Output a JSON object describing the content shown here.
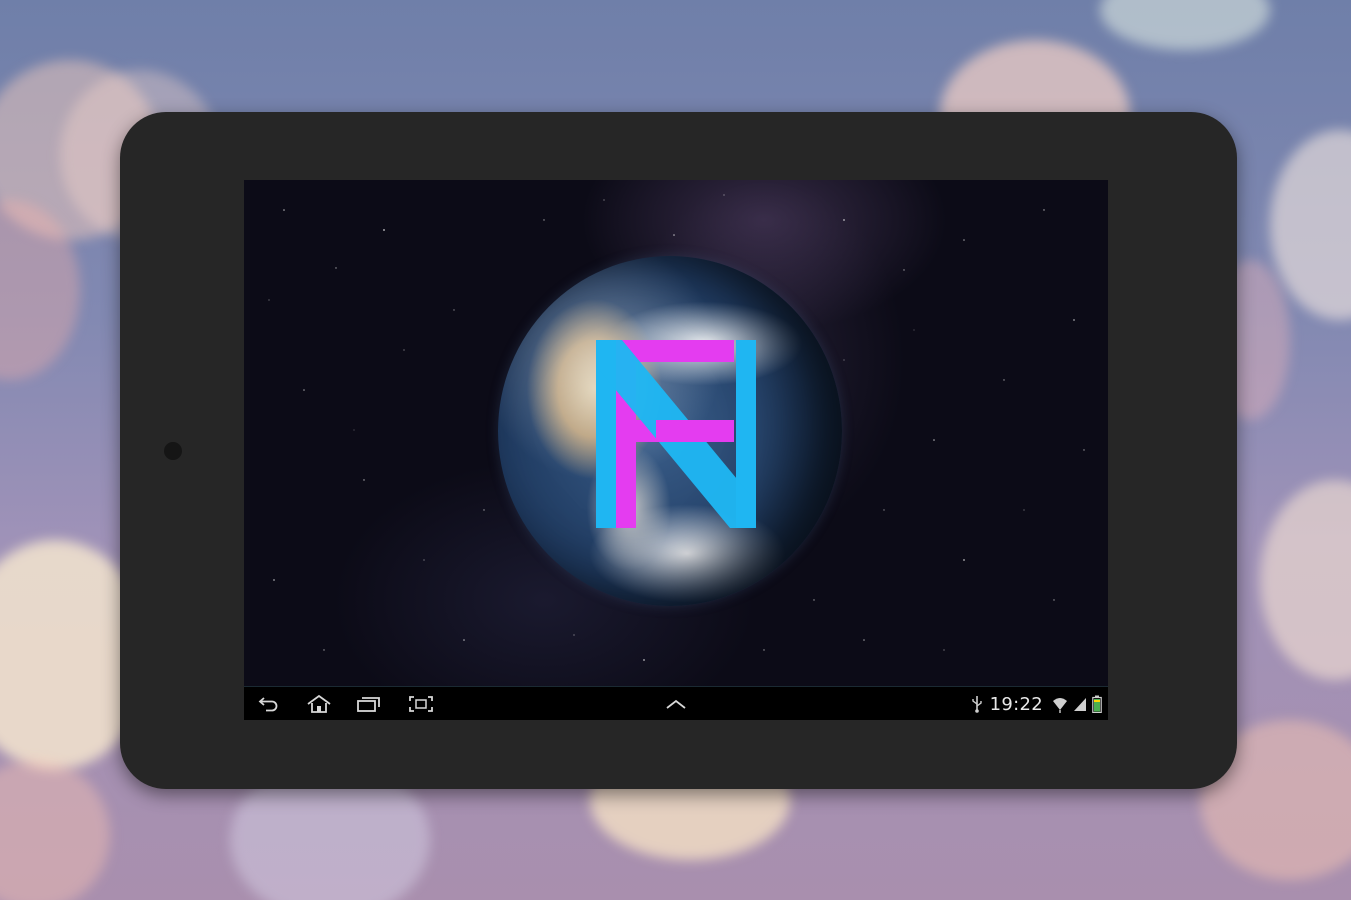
{
  "background": {
    "description_colors": [
      "#6f7fa9",
      "#a98fae",
      "#f4e3c4"
    ]
  },
  "device": {
    "type": "tablet",
    "bezel_color": "#262626"
  },
  "screen": {
    "wallpaper": {
      "subject_icon": "earth-globe",
      "logo_icon": "nf-monogram-logo",
      "logo_colors": {
        "cyan": "#1fb6f2",
        "magenta": "#e43cf0"
      }
    },
    "navigation_bar": {
      "buttons": [
        {
          "name": "back-icon"
        },
        {
          "name": "home-icon"
        },
        {
          "name": "recent-apps-icon"
        },
        {
          "name": "screenshot-icon"
        }
      ],
      "center_icon": "chevron-up-icon",
      "status": {
        "usb_icon": "usb-icon",
        "clock": "19:22",
        "wifi_icon": "wifi-icon",
        "signal_icon": "signal-icon",
        "battery_icon": "battery-icon",
        "battery_color": "#4caf50"
      }
    }
  }
}
